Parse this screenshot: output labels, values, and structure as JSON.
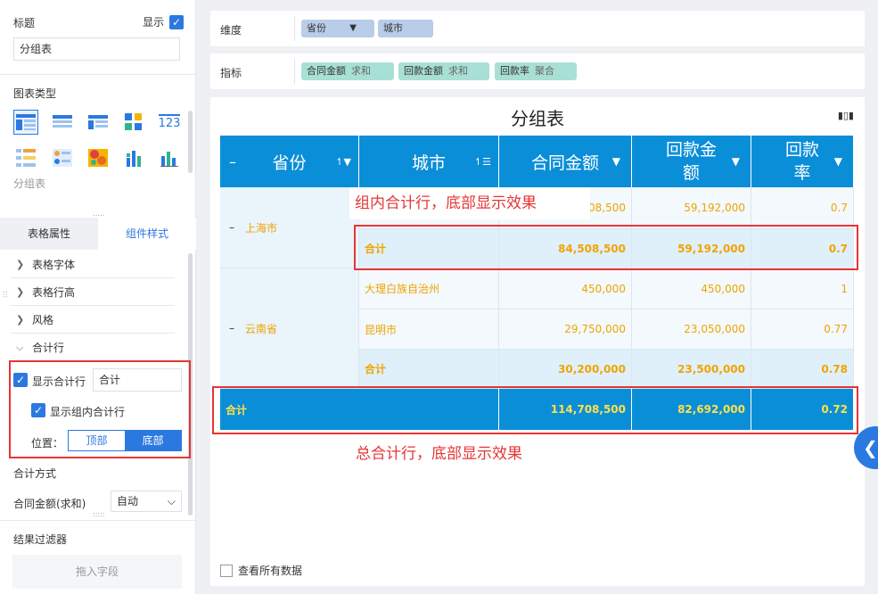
{
  "left_panel": {
    "title_label": "标题",
    "show_label": "显示",
    "title_value": "分组表",
    "chart_type_label": "图表类型",
    "chart_type_selected": "分组表",
    "tabs": [
      "表格属性",
      "组件样式"
    ],
    "tree": [
      "表格字体",
      "表格行高",
      "风格",
      "合计行"
    ],
    "show_total_label": "显示合计行",
    "total_name": "合计",
    "show_group_total_label": "显示组内合计行",
    "position_label": "位置：",
    "position_options": [
      "顶部",
      "底部"
    ],
    "agg_method_label": "合计方式",
    "agg_field_label": "合同金额(求和)",
    "agg_field_value": "自动",
    "result_filter_label": "结果过滤器",
    "drop_field_placeholder": "拖入字段"
  },
  "dimension_bar": {
    "label": "维度",
    "chips": [
      "省份",
      "城市"
    ]
  },
  "measure_bar": {
    "label": "指标",
    "chips": [
      {
        "name": "合同金额",
        "agg": "求和"
      },
      {
        "name": "回款金额",
        "agg": "求和"
      },
      {
        "name": "回款率",
        "agg": "聚合"
      }
    ]
  },
  "table": {
    "title": "分组表",
    "headers": [
      "省份",
      "城市",
      "合同金额",
      "回款金\n额",
      "回款\n率"
    ],
    "shanghai": {
      "province": "上海市",
      "row1": [
        "08,500",
        "59,192,000",
        "0.7"
      ],
      "subtotal": [
        "合计",
        "84,508,500",
        "59,192,000",
        "0.7"
      ]
    },
    "yunnan": {
      "province": "云南省",
      "row1": [
        "大理白族自治州",
        "450,000",
        "450,000",
        "1"
      ],
      "row2": [
        "昆明市",
        "29,750,000",
        "23,050,000",
        "0.77"
      ],
      "subtotal": [
        "合计",
        "30,200,000",
        "23,500,000",
        "0.78"
      ]
    },
    "grand_total": [
      "合计",
      "114,708,500",
      "82,692,000",
      "0.72"
    ]
  },
  "annotations": {
    "group_total": "组内合计行，底部显示效果",
    "grand_total": "总合计行，底部显示效果"
  },
  "view_all_label": "查看所有数据"
}
